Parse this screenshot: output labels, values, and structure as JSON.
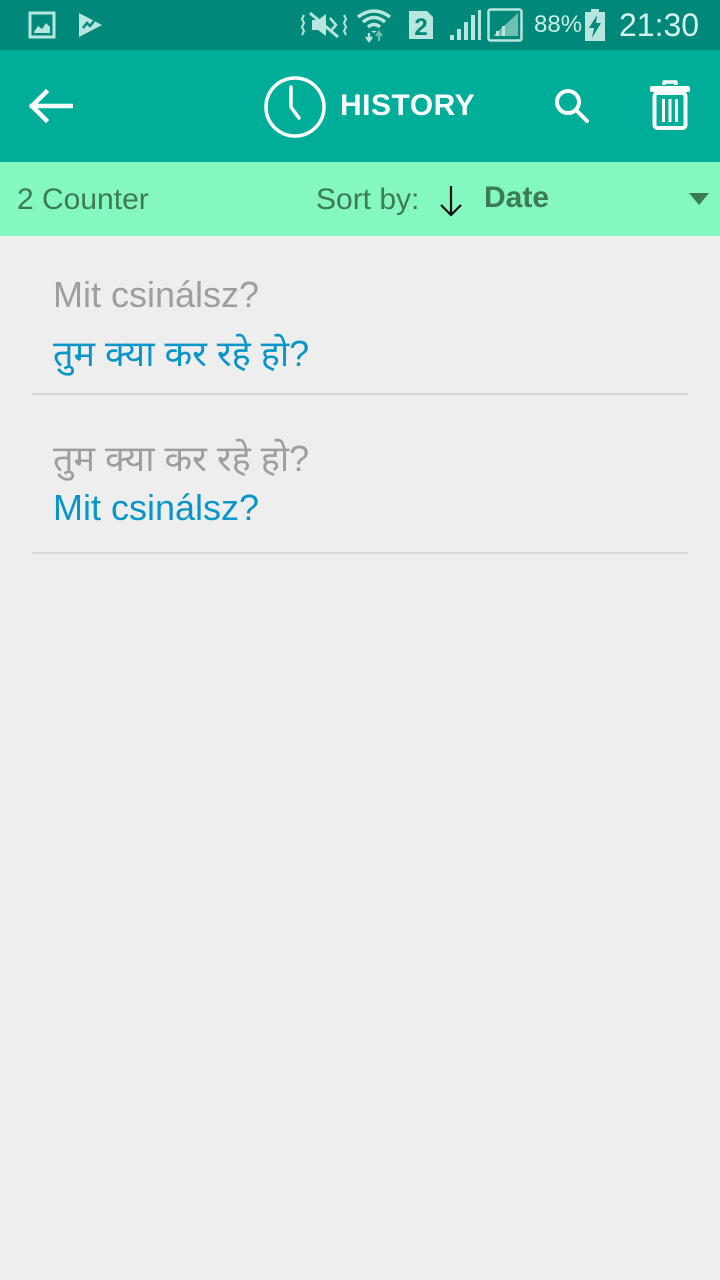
{
  "status_bar": {
    "left_icons": [
      "gallery-notification-icon",
      "play-store-notification-icon"
    ],
    "right_icons": [
      "vibrate-mute-icon",
      "wifi-icon",
      "sim-2-icon",
      "signal-icon",
      "signal-roaming-icon",
      "battery-charging-icon"
    ],
    "battery_percent": "88%",
    "time": "21:30"
  },
  "app_bar": {
    "back_icon": "arrow-left-icon",
    "title_icon": "clock-icon",
    "title": "HISTORY",
    "search_icon": "search-icon",
    "delete_icon": "trash-icon"
  },
  "sort_bar": {
    "counter": "2 Counter",
    "sort_label": "Sort by:",
    "sort_direction_icon": "arrow-down-icon",
    "sort_value": "Date",
    "dropdown_icon": "caret-down-icon"
  },
  "history": {
    "items": [
      {
        "source": "Mit csinálsz?",
        "translation": "तुम क्या कर रहे हो?"
      },
      {
        "source": "तुम क्या कर रहे हो?",
        "translation": "Mit csinálsz?"
      }
    ]
  },
  "colors": {
    "status_bar": "#00897b",
    "app_bar": "#00ad99",
    "sort_bar": "#85f7c0",
    "source_text": "#9e9e9e",
    "translation_text": "#0896c8",
    "background": "#eeeeee"
  }
}
